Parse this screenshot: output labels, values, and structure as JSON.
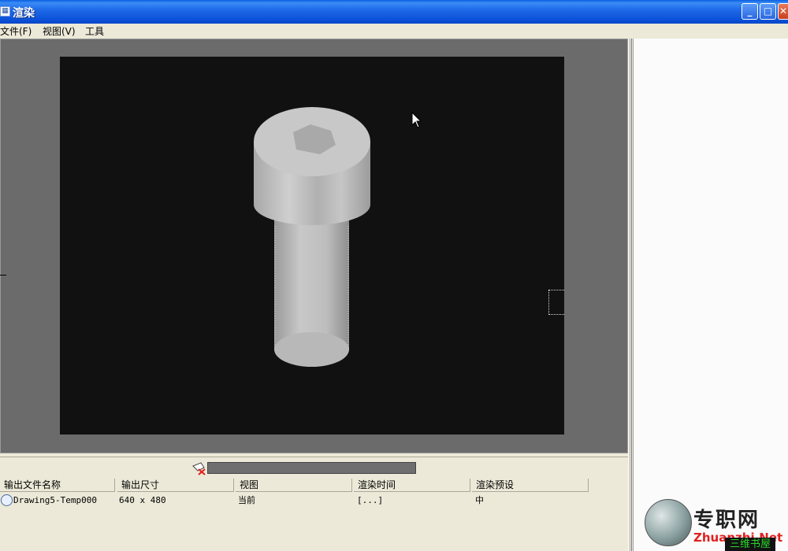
{
  "window": {
    "title": "渲染",
    "icon": "app-icon",
    "minimize": "_",
    "maximize": "□",
    "close": "✕"
  },
  "menu": [
    {
      "label": "文件(F)"
    },
    {
      "label": "视图(V)"
    },
    {
      "label": "工具"
    }
  ],
  "viewport": {
    "background": "#6b6b6b",
    "render_background": "#111111",
    "object": "hex-socket-cap-screw",
    "cursor": "pointer-cursor"
  },
  "progress": {
    "value": 0,
    "icon": "render-status-icon"
  },
  "table": {
    "headers": [
      "输出文件名称",
      "输出尺寸",
      "视图",
      "渲染时间",
      "渲染预设"
    ],
    "rows": [
      {
        "file": "Drawing5-Temp000",
        "size": "640 x 480",
        "view": "当前",
        "time": "[...]",
        "preset": "中",
        "icon": "render-entry-icon"
      }
    ]
  },
  "watermark": {
    "cn": "专职网",
    "en": "Zhuanzhi.Net",
    "sub": "三维书屋",
    "icon": "globe-logo-icon"
  }
}
